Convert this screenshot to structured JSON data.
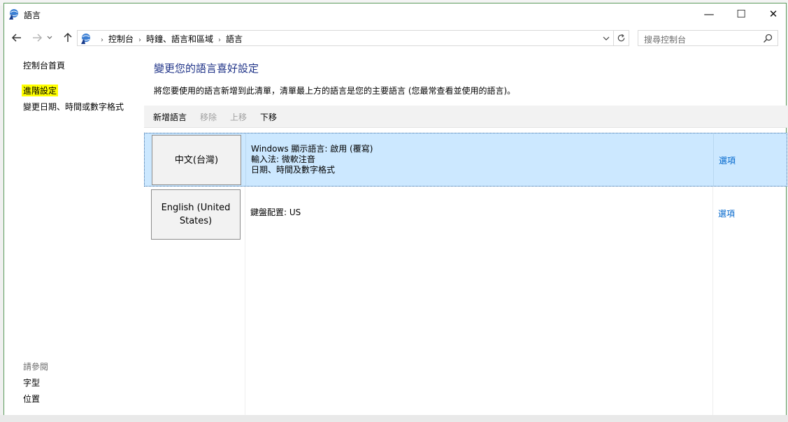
{
  "window": {
    "title": "語言",
    "minimize_glyph": "—",
    "maximize_glyph": "☐",
    "close_glyph": "✕",
    "accent": "#1e3287",
    "link_color": "#0066cc",
    "selection_color": "#cce8ff"
  },
  "nav": {
    "breadcrumbs": [
      "控制台",
      "時鐘、語言和區域",
      "語言"
    ],
    "search_placeholder": "搜尋控制台"
  },
  "sidebar": {
    "home": "控制台首頁",
    "advanced": "進階設定",
    "date_format": "變更日期、時間或數字格式",
    "see_also_heading": "請參閱",
    "see_also": [
      "字型",
      "位置"
    ]
  },
  "main": {
    "title": "變更您的語言喜好設定",
    "description": "將您要使用的語言新增到此清單，清單最上方的語言是您的主要語言 (您最常查看並使用的語言)。",
    "toolbar": {
      "add": "新增語言",
      "remove": "移除",
      "move_up": "上移",
      "move_down": "下移"
    },
    "languages": [
      {
        "name": "中文(台灣)",
        "details": [
          "Windows 顯示語言: 啟用 (覆寫)",
          "輸入法: 微軟注音",
          "日期、時間及數字格式"
        ],
        "options": "選項",
        "selected": true
      },
      {
        "name": "English (United States)",
        "details": [
          "鍵盤配置: US"
        ],
        "options": "選項",
        "selected": false
      }
    ]
  },
  "icons": [
    "control-panel-icon",
    "back-arrow-icon",
    "forward-arrow-icon",
    "recent-dropdown-icon",
    "up-arrow-icon",
    "address-dropdown-icon",
    "refresh-icon",
    "search-icon",
    "minimize-icon",
    "maximize-icon",
    "close-icon"
  ]
}
